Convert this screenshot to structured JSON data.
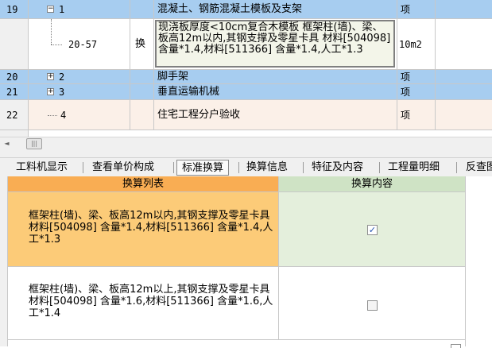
{
  "top_table": {
    "rows": [
      {
        "num": "19",
        "code": "1",
        "mark": "",
        "name": "混凝土、钢筋混凝土模板及支架",
        "unit": "项",
        "expander": "−"
      },
      {
        "num": "",
        "code": "20-57",
        "mark": "换",
        "name": "现浇板厚度<10cm复合木模板  框架柱(墙)、梁、板高12m以内,其钢支撑及零星卡具 材料[504098] 含量*1.4,材料[511366] 含量*1.4,人工*1.3",
        "unit": "10m2"
      },
      {
        "num": "20",
        "code": "2",
        "mark": "",
        "name": "脚手架",
        "unit": "项",
        "expander": "+"
      },
      {
        "num": "21",
        "code": "3",
        "mark": "",
        "name": "垂直运输机械",
        "unit": "项",
        "expander": "+"
      },
      {
        "num": "22",
        "code": "4",
        "mark": "",
        "name": "住宅工程分户验收",
        "unit": "项"
      }
    ],
    "scroll_left_arrow": "◄",
    "scroll_grip": "|||"
  },
  "tabs": [
    "工料机显示",
    "查看单价构成",
    "标准换算",
    "换算信息",
    "特征及内容",
    "工程量明细",
    "反查图"
  ],
  "active_tab": 2,
  "conv_table": {
    "headers": [
      "换算列表",
      "换算内容"
    ],
    "rows": [
      {
        "text": "框架柱(墙)、梁、板高12m以内,其钢支撑及零星卡具 材料[504098] 含量*1.4,材料[511366] 含量*1.4,人工*1.3",
        "checked": true
      },
      {
        "text": "框架柱(墙)、梁、板高12m以上,其钢支撑及零星卡具 材料[504098] 含量*1.6,材料[511366] 含量*1.6,人工*1.4",
        "checked": false
      }
    ],
    "check_mark": "✓"
  },
  "colors": {
    "selected_row": "#a7cdf0",
    "sub_row": "#fbf0e8",
    "header_orange": "#f9ad53",
    "header_green": "#cfe3c5",
    "row_orange": "#fccb78",
    "cell_green": "#e4efdc"
  }
}
